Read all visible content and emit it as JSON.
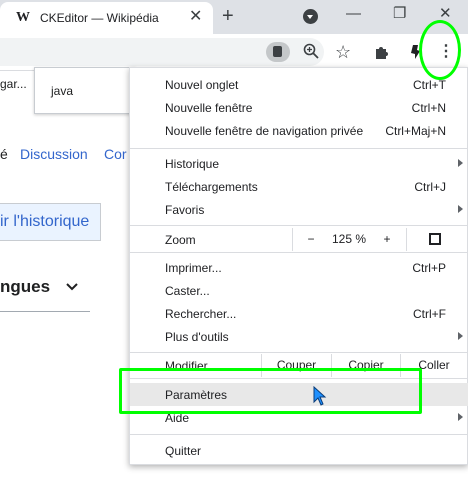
{
  "tab": {
    "favicon": "W",
    "title": "CKEditor — Wikipédia",
    "close": "✕"
  },
  "tabbar": {
    "new_tab": "+",
    "minimize": "—",
    "restore": "❐",
    "close": "✕"
  },
  "toolbar": {
    "lens_icon": "lens-icon",
    "zoom_icon": "zoom-icon",
    "star": "☆",
    "extensions": "extensions-icon",
    "menu": "⋮"
  },
  "page": {
    "fragment_left": "gar...",
    "talk_prefix": "é",
    "talk_link": "Discussion",
    "talk_cut": "Cor",
    "history_button": "ir l'historique",
    "languages": "ngues",
    "languages_chevron": "⌄"
  },
  "search_suggestion": {
    "text": "java"
  },
  "menu": {
    "new_tab": {
      "label": "Nouvel onglet",
      "shortcut": "Ctrl+T"
    },
    "new_window": {
      "label": "Nouvelle fenêtre",
      "shortcut": "Ctrl+N"
    },
    "incognito": {
      "label": "Nouvelle fenêtre de navigation privée",
      "shortcut": "Ctrl+Maj+N"
    },
    "history": {
      "label": "Historique"
    },
    "downloads": {
      "label": "Téléchargements",
      "shortcut": "Ctrl+J"
    },
    "bookmarks": {
      "label": "Favoris"
    },
    "zoom": {
      "label": "Zoom",
      "minus": "−",
      "value": "125 %",
      "plus": "+"
    },
    "print": {
      "label": "Imprimer...",
      "shortcut": "Ctrl+P"
    },
    "cast": {
      "label": "Caster..."
    },
    "find": {
      "label": "Rechercher...",
      "shortcut": "Ctrl+F"
    },
    "more_tools": {
      "label": "Plus d'outils"
    },
    "edit": {
      "label": "Modifier",
      "cut": "Couper",
      "copy": "Copier",
      "paste": "Coller"
    },
    "settings": {
      "label": "Paramètres"
    },
    "help": {
      "label": "Aide"
    },
    "quit": {
      "label": "Quitter"
    }
  },
  "colors": {
    "highlight_annotation": "#00ff00",
    "link": "#3366cc",
    "cursor": "#1e90ff"
  }
}
